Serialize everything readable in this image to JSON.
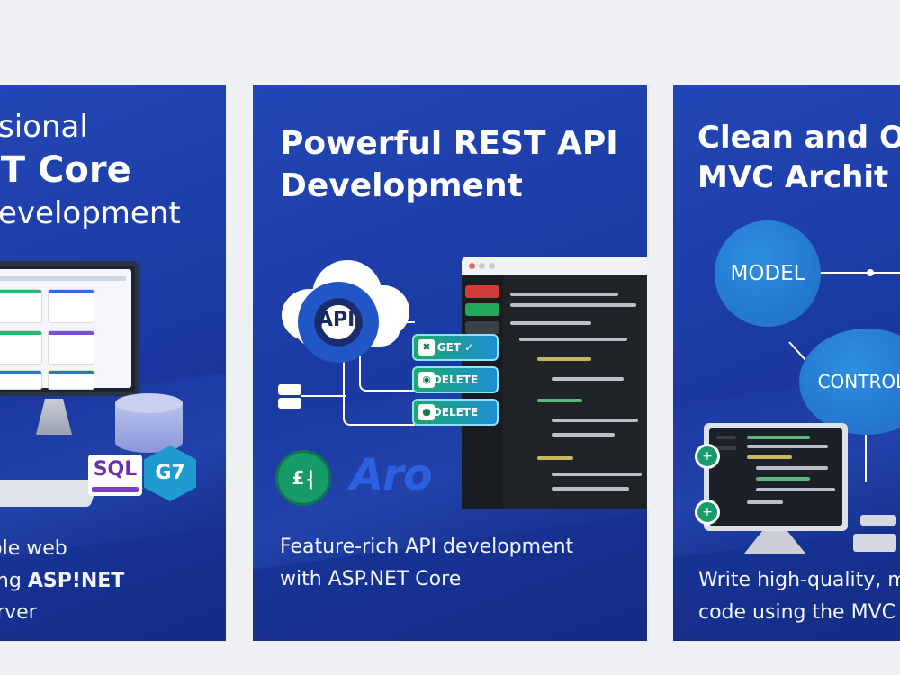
{
  "cards": [
    {
      "title": [
        "sional",
        "NET Core",
        "evelopment"
      ],
      "description": [
        "scalable web",
        "ns using ",
        "ASP!NET",
        "QL Server"
      ],
      "badges": {
        "sql": "SQL",
        "hex": "G7"
      }
    },
    {
      "title": [
        "Powerful REST API",
        "Development"
      ],
      "api_label": "API",
      "endpoints": [
        {
          "icon": "✖",
          "label": "GET ✓"
        },
        {
          "icon": "◉",
          "label": "DELETE"
        },
        {
          "icon": "●",
          "label": "DELETE"
        }
      ],
      "logos": {
        "coin": "£⸡",
        "aro": "Aro"
      },
      "description": [
        "Feature-rich API development",
        "with ASP.NET Core"
      ]
    },
    {
      "title": [
        "Clean and Or",
        "MVC Archit"
      ],
      "bubbles": {
        "model": "MODEL",
        "controller": "CONTROLL"
      },
      "description": [
        "Write high-quality, ma",
        "code using the MVC p"
      ]
    }
  ],
  "colors": {
    "card_bg": "#1b3aa3",
    "page_bg": "#eef0f4",
    "accent_green": "#19a86b",
    "accent_blue": "#1f8fd6"
  },
  "icons": [
    "cloud-icon",
    "gear-icon",
    "database-icon",
    "monitor-icon",
    "check-icon"
  ]
}
